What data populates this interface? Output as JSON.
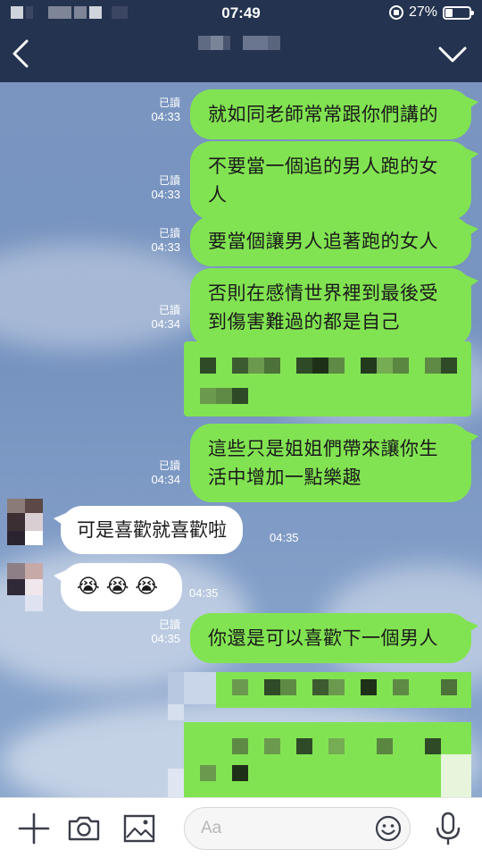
{
  "status_bar": {
    "time": "07:49",
    "battery_percent": "27%",
    "battery_level": 0.27
  },
  "header": {
    "back_icon": "chevron-left-icon",
    "menu_icon": "chevron-down-icon"
  },
  "messages": [
    {
      "side": "out",
      "text": "就如同老師常常跟你們講的",
      "read": "已讀",
      "time": "04:33"
    },
    {
      "side": "out",
      "text": "不要當一個追的男人跑的女人",
      "read": "已讀",
      "time": "04:33"
    },
    {
      "side": "out",
      "text": "要當個讓男人追著跑的女人",
      "read": "已讀",
      "time": "04:33"
    },
    {
      "side": "out",
      "text": "否則在感情世界裡到最後受到傷害難過的都是自己",
      "read": "已讀",
      "time": "04:34"
    },
    {
      "side": "out",
      "text": "這些只是姐姐們帶來讓你生活中增加一點樂趣",
      "read": "已讀",
      "time": "04:34"
    },
    {
      "side": "in",
      "text": "可是喜歡就喜歡啦",
      "time": "04:35"
    },
    {
      "side": "in",
      "text": "😭 😭 😭",
      "time": "04:35"
    },
    {
      "side": "out",
      "text": "你還是可以喜歡下一個男人",
      "read": "已讀",
      "time": "04:35"
    }
  ],
  "input_bar": {
    "placeholder": "Aa",
    "icons": [
      "plus-icon",
      "camera-icon",
      "image-icon",
      "emoji-icon",
      "microphone-icon"
    ]
  },
  "colors": {
    "header_bg": "#24334f",
    "outgoing_bubble": "#82e352",
    "incoming_bubble": "#ffffff",
    "chat_bg": "#7a95c0"
  }
}
